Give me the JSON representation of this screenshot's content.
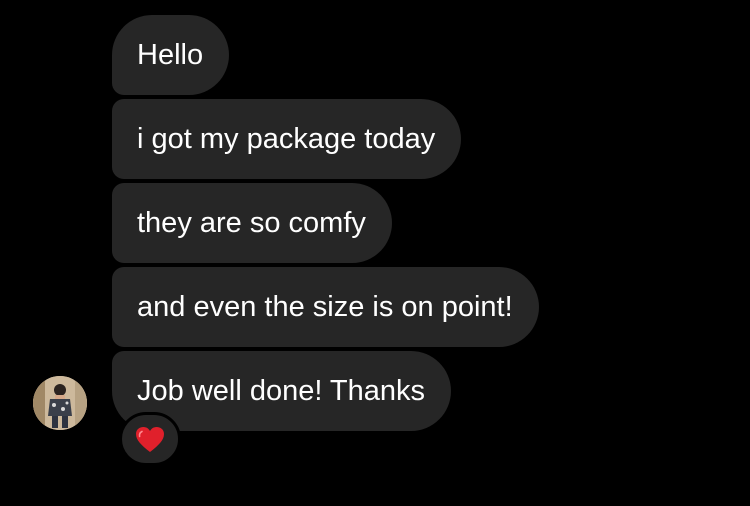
{
  "thread": {
    "messages": [
      {
        "text": "Hello"
      },
      {
        "text": "i got my package today"
      },
      {
        "text": "they are so comfy"
      },
      {
        "text": "and even the size is on point!"
      },
      {
        "text": "Job well done! Thanks"
      }
    ],
    "sender_avatar": {
      "icon": "user-avatar"
    },
    "reaction": {
      "icon": "red-heart-icon",
      "color": "#e0202b"
    }
  },
  "colors": {
    "background": "#000000",
    "bubble": "#262626",
    "text": "#ffffff"
  }
}
